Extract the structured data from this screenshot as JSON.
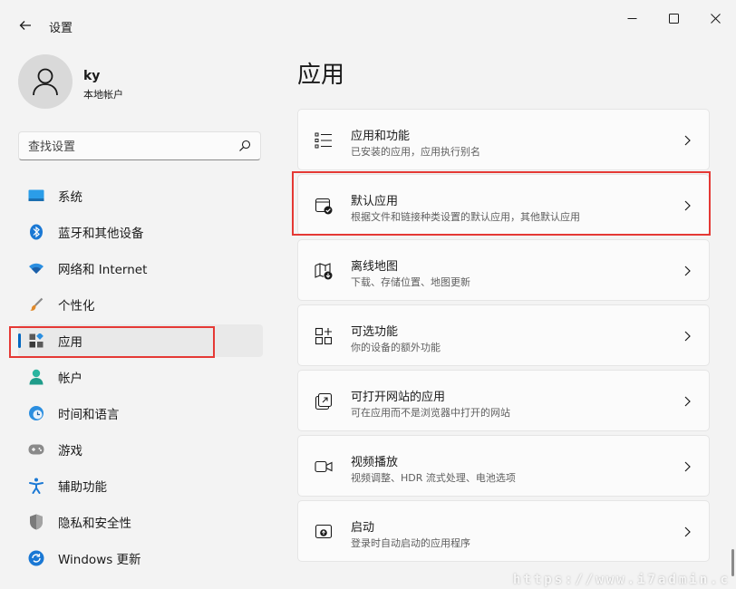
{
  "window": {
    "title": "设置"
  },
  "profile": {
    "name": "ky",
    "account_type": "本地帐户"
  },
  "search": {
    "placeholder": "查找设置"
  },
  "sidebar": {
    "items": [
      {
        "label": "系统",
        "icon": "system-icon"
      },
      {
        "label": "蓝牙和其他设备",
        "icon": "bluetooth-icon"
      },
      {
        "label": "网络和 Internet",
        "icon": "wifi-icon"
      },
      {
        "label": "个性化",
        "icon": "brush-icon"
      },
      {
        "label": "应用",
        "icon": "apps-icon",
        "selected": true
      },
      {
        "label": "帐户",
        "icon": "account-icon"
      },
      {
        "label": "时间和语言",
        "icon": "time-language-icon"
      },
      {
        "label": "游戏",
        "icon": "gamepad-icon"
      },
      {
        "label": "辅助功能",
        "icon": "accessibility-icon"
      },
      {
        "label": "隐私和安全性",
        "icon": "shield-icon"
      },
      {
        "label": "Windows 更新",
        "icon": "update-icon"
      }
    ]
  },
  "main": {
    "title": "应用",
    "cards": [
      {
        "title": "应用和功能",
        "desc": "已安装的应用，应用执行别名",
        "icon": "list-icon"
      },
      {
        "title": "默认应用",
        "desc": "根据文件和链接种类设置的默认应用，其他默认应用",
        "icon": "default-apps-icon"
      },
      {
        "title": "离线地图",
        "desc": "下载、存储位置、地图更新",
        "icon": "map-icon"
      },
      {
        "title": "可选功能",
        "desc": "你的设备的额外功能",
        "icon": "optional-features-icon"
      },
      {
        "title": "可打开网站的应用",
        "desc": "可在应用而不是浏览器中打开的网站",
        "icon": "open-external-icon"
      },
      {
        "title": "视频播放",
        "desc": "视频调整、HDR 流式处理、电池选项",
        "icon": "video-icon"
      },
      {
        "title": "启动",
        "desc": "登录时自动启动的应用程序",
        "icon": "startup-icon"
      }
    ]
  },
  "colors": {
    "accent": "#0067c0",
    "highlight": "#e53935"
  },
  "watermark": "https://www.i7admin.c"
}
